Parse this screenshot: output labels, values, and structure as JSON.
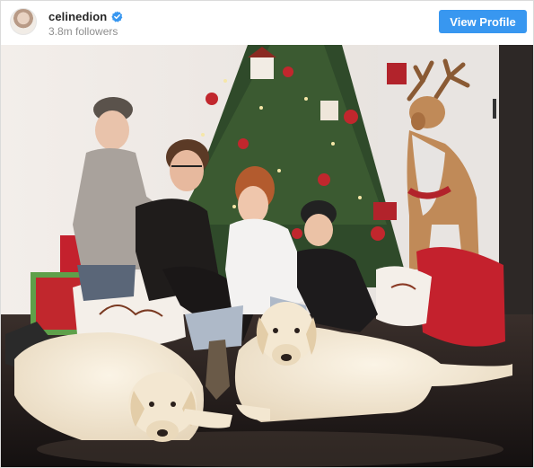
{
  "post": {
    "username": "celinedion",
    "followers": "3.8m followers",
    "view_profile_label": "View Profile",
    "verified": true
  },
  "colors": {
    "accent": "#3897f0",
    "username": "#262626",
    "secondary_text": "#8e8e8e",
    "border": "#dbdbdb"
  },
  "icons": [
    "avatar",
    "verified-badge-icon"
  ]
}
